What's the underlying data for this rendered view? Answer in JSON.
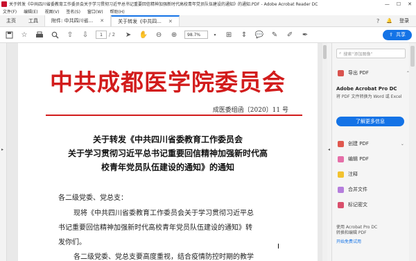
{
  "window": {
    "title": "关于转发《中共四川省委教育工作委员会关于学习贯彻习近平总书记重要回信精神加强新时代高校青年党员队伍建设的通知》的通知.PDF - Adobe Acrobat Reader DC",
    "minimize": "—",
    "maximize": "☐",
    "close": "✕"
  },
  "menu": {
    "items": [
      "文件(F)",
      "编辑(E)",
      "视图(V)",
      "签名(S)",
      "窗口(W)",
      "帮助(H)"
    ]
  },
  "tabs": {
    "home": "主页",
    "tools": "工具",
    "doc1": "附件: 中共四川省...",
    "doc2": "关于转发《中共四...",
    "help_icon": "?",
    "bell_icon": "🔔",
    "login": "登录"
  },
  "toolbar": {
    "page_current": "1",
    "page_total": "/ 2",
    "zoom": "98.7%",
    "share": "共享"
  },
  "document": {
    "header": "中共成都医学院委员会",
    "number": "成医委组函〔2020〕11 号",
    "title_line1": "关于转发《中共四川省委教育工作委员会",
    "title_line2": "关于学习贯彻习近平总书记重要回信精神加强新时代高",
    "title_line3": "校青年党员队伍建设的通知》的通知",
    "salutation": "各二级党委、党总支：",
    "para1_line1": "现将《中共四川省委教育工作委员会关于学习贯彻习近平总",
    "para1_line2": "书记重要回信精神加强新时代高校青年党员队伍建设的通知》转",
    "para1_line3": "发你们。",
    "para2_line1": "各二级党委、党总支要高度重视，结合疫情防控时期的教学"
  },
  "sidepanel": {
    "search_placeholder": "搜索“添加图像”",
    "export_pdf": "导出 PDF",
    "promo_title": "Adobe Acrobat Pro DC",
    "promo_desc": "将 PDF 文件转换为 Word 或 Excel",
    "promo_button": "了解更多信息",
    "tools": [
      "创建 PDF",
      "编辑 PDF",
      "注释",
      "合并文件",
      "标记密文"
    ],
    "footer_line1": "使用 Acrobat Pro DC",
    "footer_line2": "转换和编辑 PDF",
    "footer_link": "开始免费试用"
  },
  "colors": {
    "accent": "#1473e6",
    "header_red": "#d21c1c"
  }
}
